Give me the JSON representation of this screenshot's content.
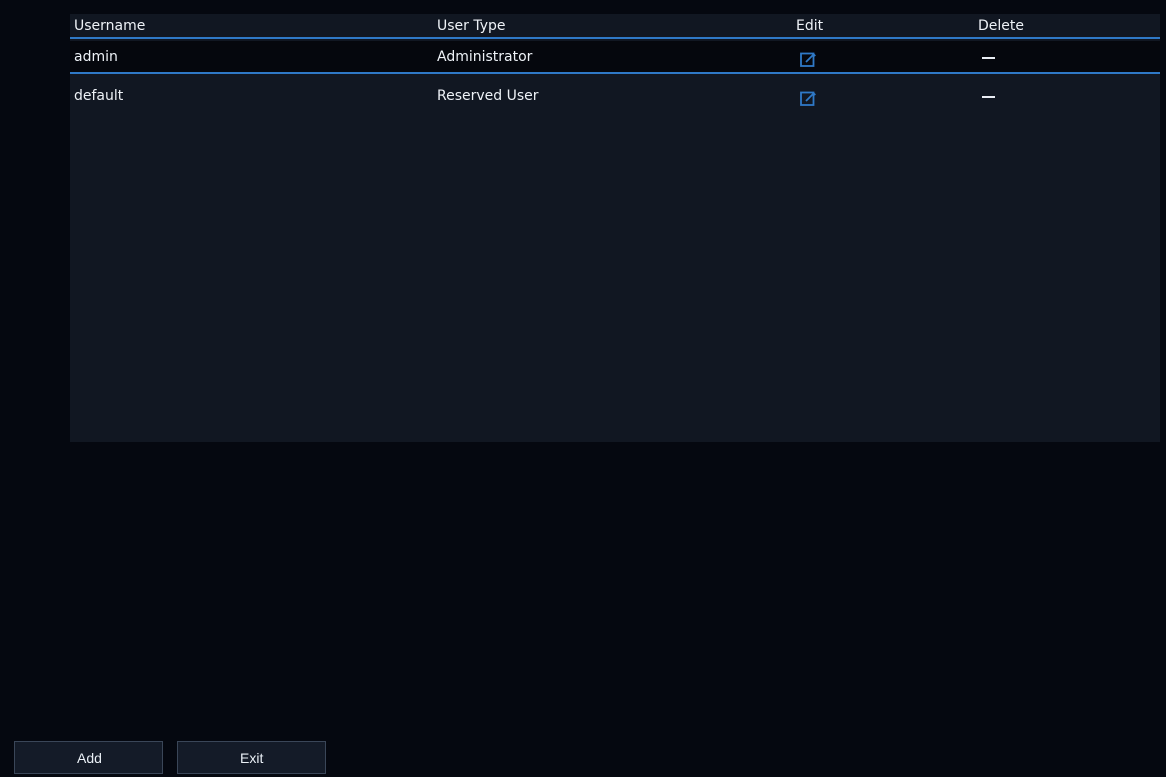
{
  "table": {
    "columns": [
      "Username",
      "User Type",
      "Edit",
      "Delete"
    ],
    "rows": [
      {
        "username": "admin",
        "user_type": "Administrator",
        "edit_icon": "edit-icon",
        "delete_text": "—"
      },
      {
        "username": "default",
        "user_type": "Reserved User",
        "edit_icon": "edit-icon",
        "delete_text": "—"
      }
    ]
  },
  "buttons": {
    "add_label": "Add",
    "exit_label": "Exit"
  },
  "colors": {
    "accent": "#2f79c7",
    "panel": "#111722",
    "background": "#050810"
  }
}
